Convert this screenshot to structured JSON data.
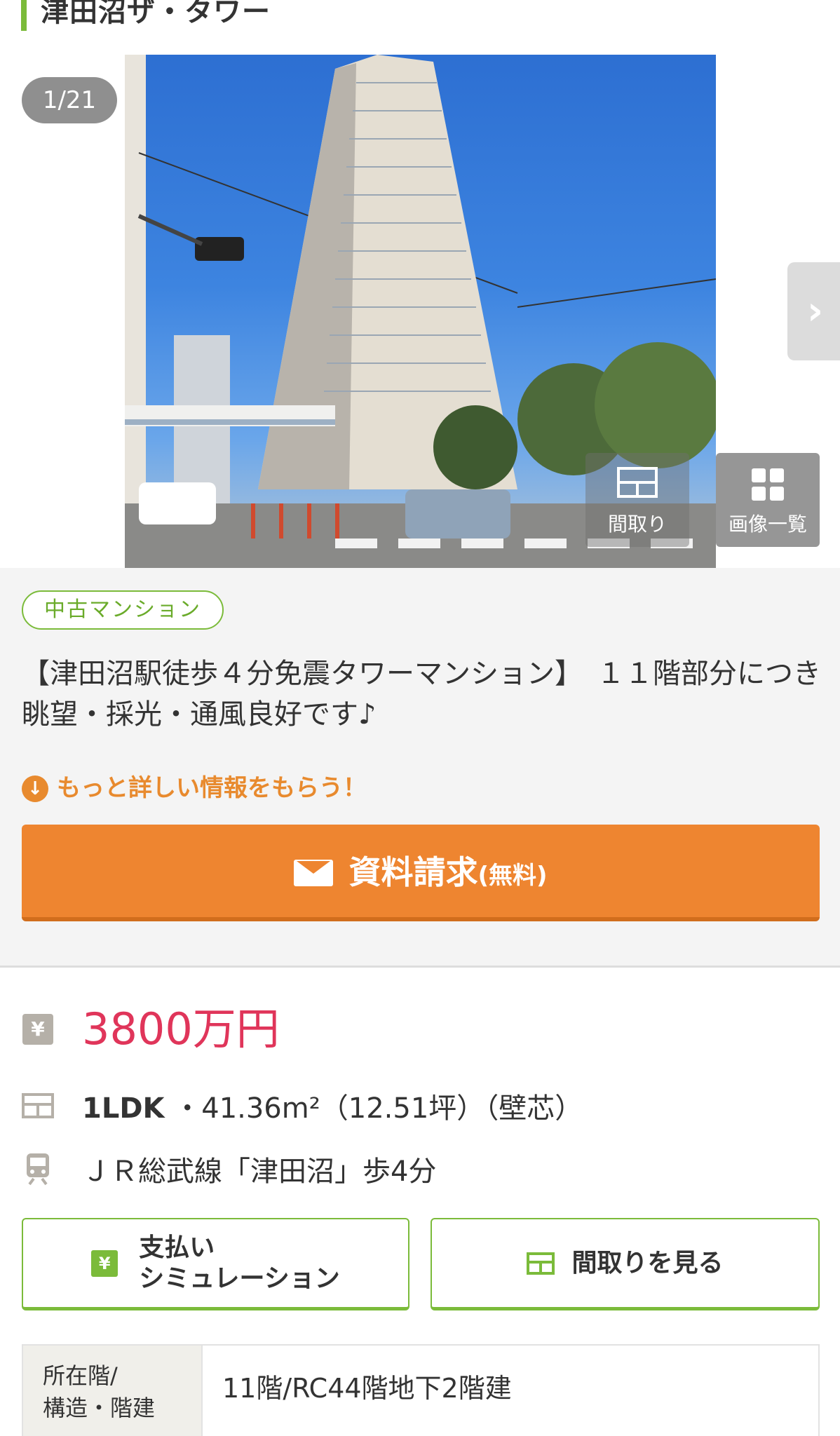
{
  "header": {
    "title": "津田沼ザ・タワー"
  },
  "gallery": {
    "counter": "1/21",
    "floor_plan_label": "間取り",
    "image_list_label": "画像一覧",
    "next_icon": "chevron-right-icon"
  },
  "listing": {
    "tag": "中古マンション",
    "catchcopy": "【津田沼駅徒歩４分免震タワーマンション】　１１階部分につき眺望・採光・通風良好です♪",
    "more_info": "もっと詳しい情報をもらう！",
    "request_button": "資料請求",
    "request_free": "(無料)"
  },
  "summary": {
    "price": "3800万円",
    "layout": "1LDK",
    "area": "・41.36m²（12.51坪）（壁芯）",
    "access": "ＪＲ総武線「津田沼」歩4分"
  },
  "actions": {
    "payment_line1": "支払い",
    "payment_line2": "シミュレーション",
    "floorplan": "間取りを見る"
  },
  "details": {
    "floor_label_line1": "所在階/",
    "floor_label_line2": "構造・階建",
    "floor_value": "11階/RC44階地下2階建"
  },
  "colors": {
    "accent_green": "#7bbb3a",
    "accent_orange": "#ee8530",
    "price_red": "#e0355a"
  }
}
